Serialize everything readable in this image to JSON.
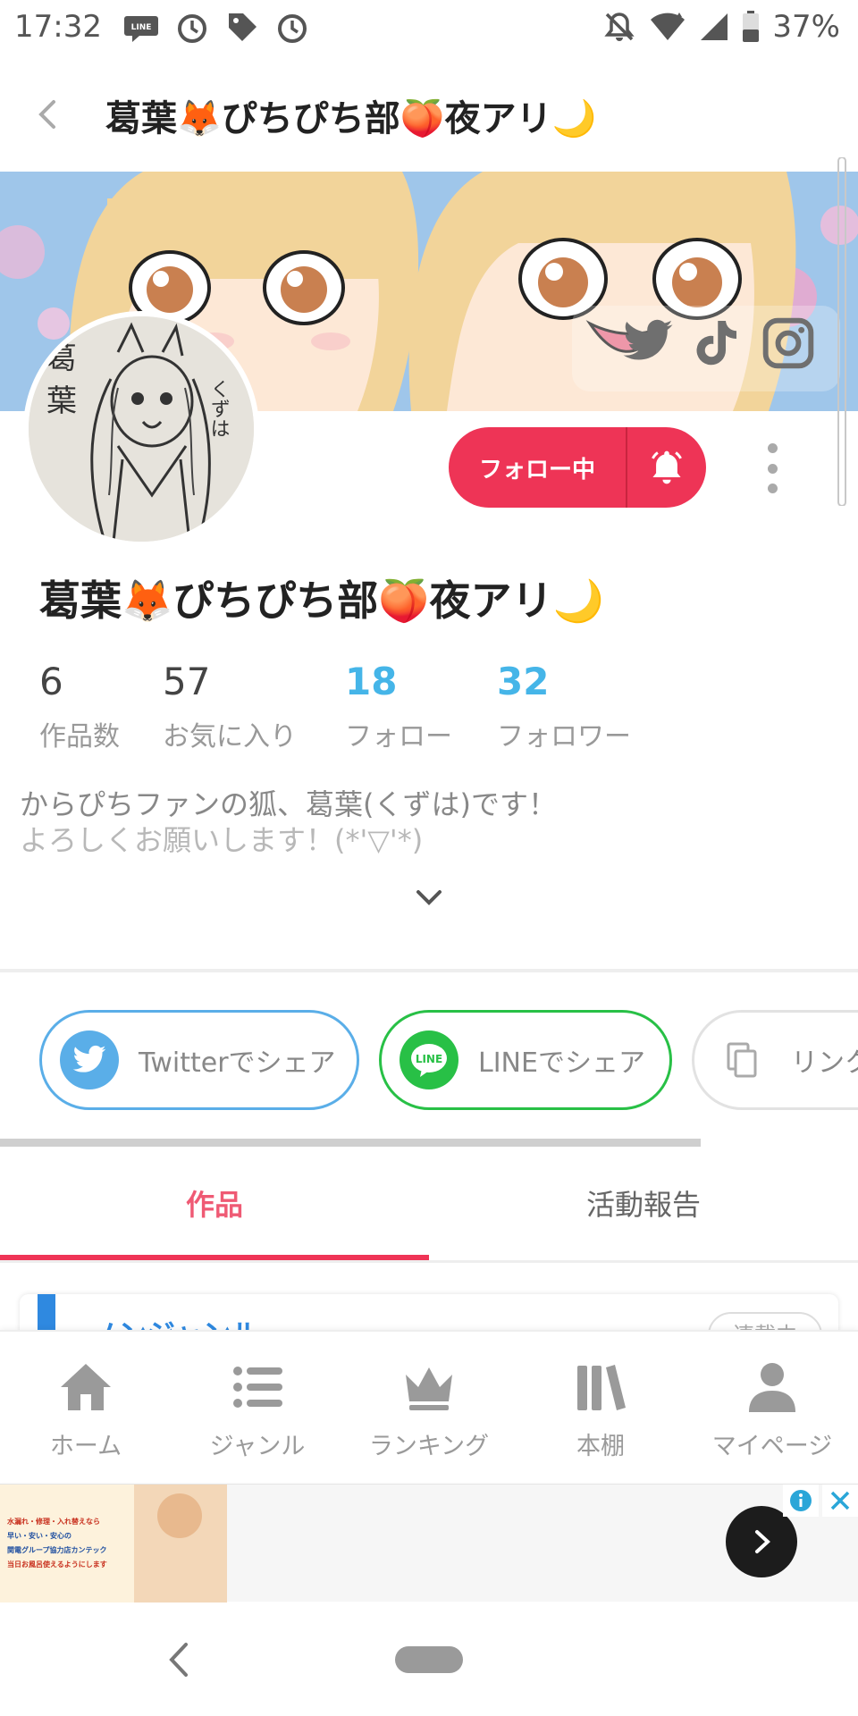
{
  "status_bar": {
    "time": "17:32",
    "line_badge": "LINE",
    "battery": "37%",
    "icons": [
      "line-icon",
      "alarm-icon",
      "tag-icon",
      "alarm-icon",
      "notifications-off-icon",
      "wifi-icon",
      "signal-icon",
      "battery-icon"
    ]
  },
  "header": {
    "title": "葛葉🦊ぴちぴち部🍑夜アリ🌙"
  },
  "profile": {
    "name": "葛葉🦊ぴちぴち部🍑夜アリ🌙",
    "avatar_text": [
      "葛",
      "葉",
      "くずは"
    ],
    "follow_label": "フォロー中",
    "stats": [
      {
        "value": "6",
        "label": "作品数"
      },
      {
        "value": "57",
        "label": "お気に入り"
      },
      {
        "value": "18",
        "label": "フォロー"
      },
      {
        "value": "32",
        "label": "フォロワー"
      }
    ],
    "bio_line1": "からぴちファンの狐、葛葉(くずは)です！",
    "bio_line2": "よろしくお願いします！(*'▽'*)"
  },
  "share": {
    "twitter": "Twitterでシェア",
    "line": "LINEでシェア",
    "line_icon_text": "LINE",
    "link": "リンク"
  },
  "tabs": {
    "works": "作品",
    "activity": "活動報告"
  },
  "card": {
    "title": "ノンジャンル",
    "badge": "連載中"
  },
  "bottom_nav": [
    {
      "label": "ホーム",
      "icon": "home-icon"
    },
    {
      "label": "ジャンル",
      "icon": "list-icon"
    },
    {
      "label": "ランキング",
      "icon": "crown-icon"
    },
    {
      "label": "本棚",
      "icon": "bookshelf-icon"
    },
    {
      "label": "マイページ",
      "icon": "person-icon"
    }
  ],
  "ad": {
    "lines": [
      "水漏れ・修理・入れ替えなら",
      "早い・安い・安心の",
      "関電グループ協力店カンテック",
      "当日お風呂使えるようにします"
    ]
  },
  "colors": {
    "accent_red": "#ee3456",
    "tab_pink": "#ef5a74",
    "stat_blue": "#45b5e8",
    "twitter_blue": "#5aaee8",
    "line_green": "#28c046",
    "card_blue": "#2f89e0"
  }
}
